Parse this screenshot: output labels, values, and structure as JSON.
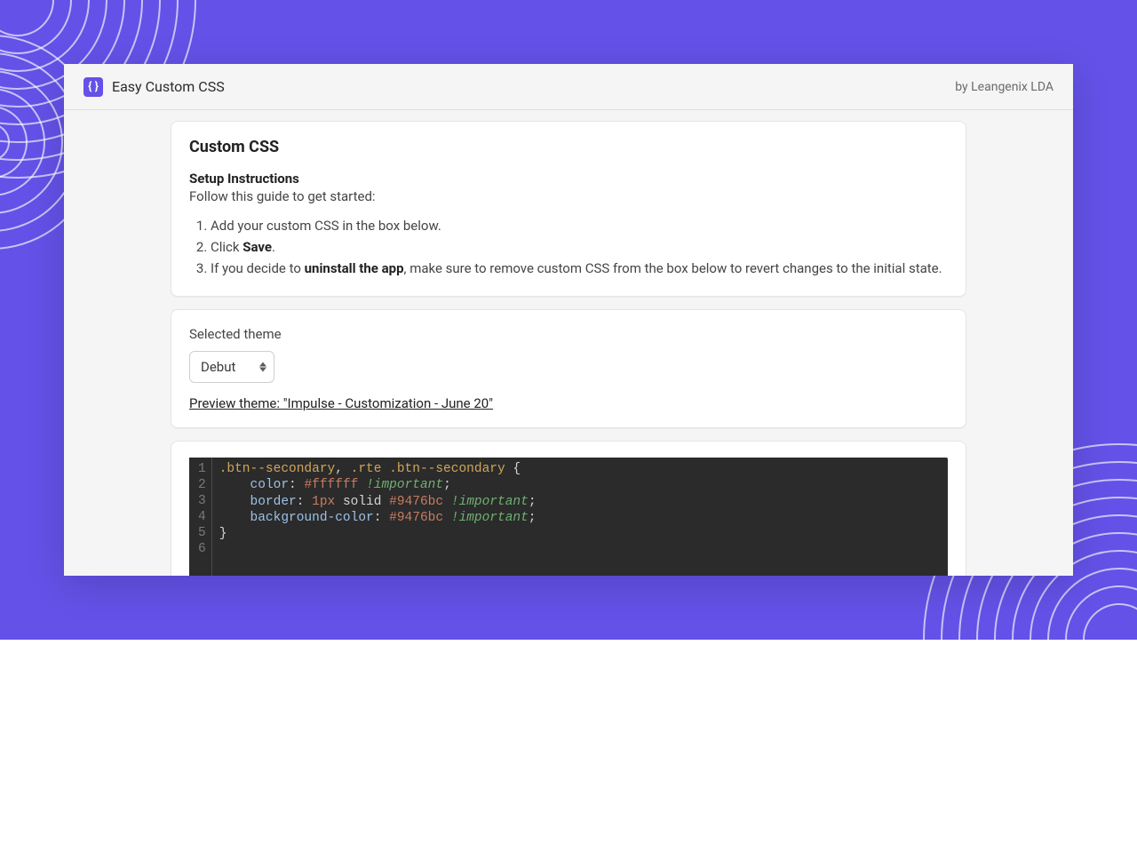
{
  "header": {
    "brand_glyph": "{ }",
    "brand_name": "Easy Custom CSS",
    "by_label": "by Leangenix LDA"
  },
  "instructions": {
    "title": "Custom CSS",
    "setup_heading": "Setup Instructions",
    "lead": "Follow this guide to get started:",
    "step1": "Add your custom CSS in the box below.",
    "step2_prefix": "Click ",
    "step2_bold": "Save",
    "step2_suffix": ".",
    "step3_prefix": "If you decide to ",
    "step3_bold": "uninstall the app",
    "step3_suffix": ", make sure to remove custom CSS from the box below to revert changes to the initial state."
  },
  "theme": {
    "label": "Selected theme",
    "selected": "Debut",
    "preview_link": "Preview theme: \"Impulse - Customization - June 20\""
  },
  "editor": {
    "line_numbers": [
      "1",
      "2",
      "3",
      "4",
      "5",
      "6"
    ],
    "l1_sel_a": ".btn--secondary",
    "l1_sep": ", ",
    "l1_sel_b": ".rte .btn--secondary",
    "l1_brace": " {",
    "l2_prop": "color",
    "l2_colon": ": ",
    "l2_val": "#ffffff",
    "l2_sp": " ",
    "l2_bang": "!important",
    "l2_semi": ";",
    "l3_prop": "border",
    "l3_colon": ": ",
    "l3_val_num": "1px",
    "l3_val_txt": " solid ",
    "l3_val_hex": "#9476bc",
    "l3_sp": " ",
    "l3_bang": "!important",
    "l3_semi": ";",
    "l4_prop": "background-color",
    "l4_colon": ": ",
    "l4_val": "#9476bc",
    "l4_sp": " ",
    "l4_bang": "!important",
    "l4_semi": ";",
    "l5_brace": "}"
  },
  "indent": "    "
}
